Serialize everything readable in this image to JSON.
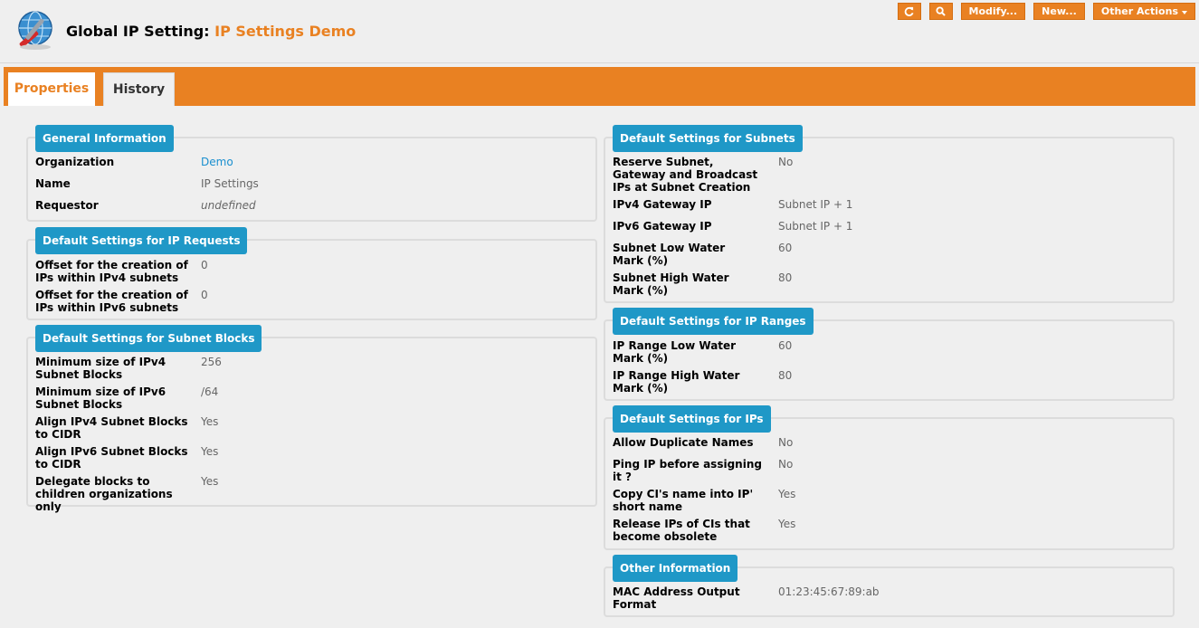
{
  "header": {
    "title_prefix": "Global IP Setting:",
    "title_object": "IP Settings Demo",
    "logo_icon": "network-tools-icon"
  },
  "actions": {
    "refresh_icon": "refresh-icon",
    "search_icon": "search-icon",
    "modify_label": "Modify...",
    "new_label": "New...",
    "other_label": "Other Actions"
  },
  "tabs": [
    {
      "label": "Properties"
    },
    {
      "label": "History"
    }
  ],
  "general": {
    "legend": "General Information",
    "rows": [
      {
        "label": "Organization",
        "value": "Demo"
      },
      {
        "label": "Name",
        "value": "IP Settings"
      },
      {
        "label": "Requestor",
        "value": "undefined"
      }
    ]
  },
  "ip_requests": {
    "legend": "Default Settings for IP Requests",
    "rows": [
      {
        "label": "Offset for the creation of IPs within IPv4 subnets",
        "value": "0"
      },
      {
        "label": "Offset for the creation of IPs within IPv6 subnets",
        "value": "0"
      }
    ]
  },
  "subnet_blocks": {
    "legend": "Default Settings for Subnet Blocks",
    "rows": [
      {
        "label": "Minimum size of IPv4 Subnet Blocks",
        "value": "256"
      },
      {
        "label": "Minimum size of IPv6 Subnet Blocks",
        "value": "/64"
      },
      {
        "label": "Align IPv4 Subnet Blocks to CIDR",
        "value": "Yes"
      },
      {
        "label": "Align IPv6 Subnet Blocks to CIDR",
        "value": "Yes"
      },
      {
        "label": "Delegate blocks to children organizations only",
        "value": "Yes"
      }
    ]
  },
  "subnets": {
    "legend": "Default Settings for Subnets",
    "rows": [
      {
        "label": "Reserve Subnet, Gateway and Broadcast IPs at Subnet Creation",
        "value": "No"
      },
      {
        "label": "IPv4 Gateway IP",
        "value": "Subnet IP + 1"
      },
      {
        "label": "IPv6 Gateway IP",
        "value": "Subnet IP + 1"
      },
      {
        "label": "Subnet Low Water Mark (%)",
        "value": "60"
      },
      {
        "label": "Subnet High Water Mark (%)",
        "value": "80"
      }
    ]
  },
  "ip_ranges": {
    "legend": "Default Settings for IP Ranges",
    "rows": [
      {
        "label": "IP Range Low Water Mark (%)",
        "value": "60"
      },
      {
        "label": "IP Range High Water Mark (%)",
        "value": "80"
      }
    ]
  },
  "ips": {
    "legend": "Default Settings for IPs",
    "rows": [
      {
        "label": "Allow Duplicate Names",
        "value": "No"
      },
      {
        "label": "Ping IP before assigning it ?",
        "value": "No"
      },
      {
        "label": "Copy CI's name into IP' short name",
        "value": "Yes"
      },
      {
        "label": "Release IPs of CIs that become obsolete",
        "value": "Yes"
      }
    ]
  },
  "other": {
    "legend": "Other Information",
    "rows": [
      {
        "label": "MAC Address Output Format",
        "value": "01:23:45:67:89:ab"
      }
    ]
  }
}
